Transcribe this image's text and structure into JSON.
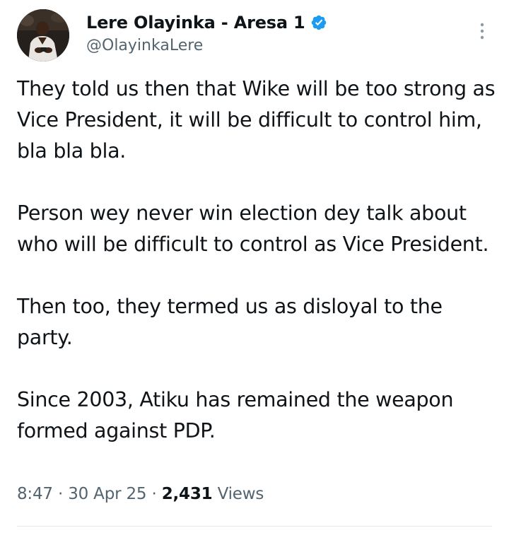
{
  "author": {
    "display_name": "Lere Olayinka - Aresa 1",
    "handle": "@OlayinkaLere",
    "verified": true,
    "avatar_icon": "profile-photo"
  },
  "tweet": {
    "paragraphs": [
      "They told us then that Wike will be too strong as Vice President, it will be difficult to control him, bla bla bla.",
      "Person wey never win election dey talk about who will be difficult to control as Vice President.",
      "Then too, they termed us as disloyal to the party.",
      "Since 2003, Atiku has remained the weapon formed against PDP."
    ]
  },
  "meta": {
    "time": "8:47",
    "separator": " · ",
    "date": "30 Apr 25",
    "views_count": "2,431",
    "views_label": " Views"
  },
  "icons": {
    "verified": "verified-badge-icon",
    "more": "more-options-icon"
  },
  "colors": {
    "verified_blue": "#1d9bf0",
    "text_primary": "#0f1419",
    "text_secondary": "#536471"
  }
}
